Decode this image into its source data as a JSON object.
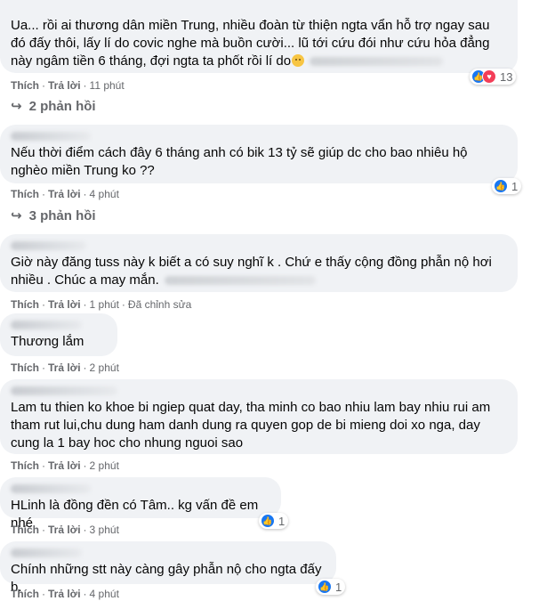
{
  "labels": {
    "like": "Thích",
    "reply": "Trả lời",
    "edited": "Đã chỉnh sửa"
  },
  "comments": [
    {
      "text": "Ua... rồi ai thương dân miền Trung, nhiều đoàn từ thiện ngta vẩn hỗ trợ ngay sau đó đấy thôi, lấy lí do covic nghe mà buồn cười... lũ tới cứu đói như cứu hỏa đẳng này ngâm tiền 6 tháng, đợi ngta ta phốt rồi lí do",
      "time": "11 phút",
      "reactions": "13"
    },
    {
      "text": "Nếu thời điểm cách đây 6 tháng anh có bik 13 tỷ sẽ giúp dc cho bao nhiêu hộ nghèo miền Trung ko ??",
      "time": "4 phút",
      "reactions": "1"
    },
    {
      "text": "Giờ này đăng tuss này k biết a có suy nghĩ k . Chứ e thấy cộng đồng phẫn nộ hơi nhiều . Chúc a may mắn.",
      "time": "1 phút"
    },
    {
      "text": "Thương lắm",
      "time": "2 phút"
    },
    {
      "text": "Lam tu thien ko khoe bi ngiep quat day, tha minh co bao nhiu lam bay nhiu rui am tham rut lui,chu dung ham danh dung ra quyen gop de bi mieng doi xo nga, day cung la 1 bay hoc cho nhung nguoi sao",
      "time": "2 phút"
    },
    {
      "text": "HLinh là đồng đền có Tâm.. kg vấn đề em nhé",
      "time": "3 phút",
      "reactions": "1"
    },
    {
      "text": "Chính những stt này càng gây phẫn nộ cho ngta đấy b.",
      "time": "4 phút",
      "reactions": "1"
    }
  ],
  "reply_threads": [
    {
      "label": "2 phản hồi"
    },
    {
      "label": "3 phản hồi"
    }
  ]
}
